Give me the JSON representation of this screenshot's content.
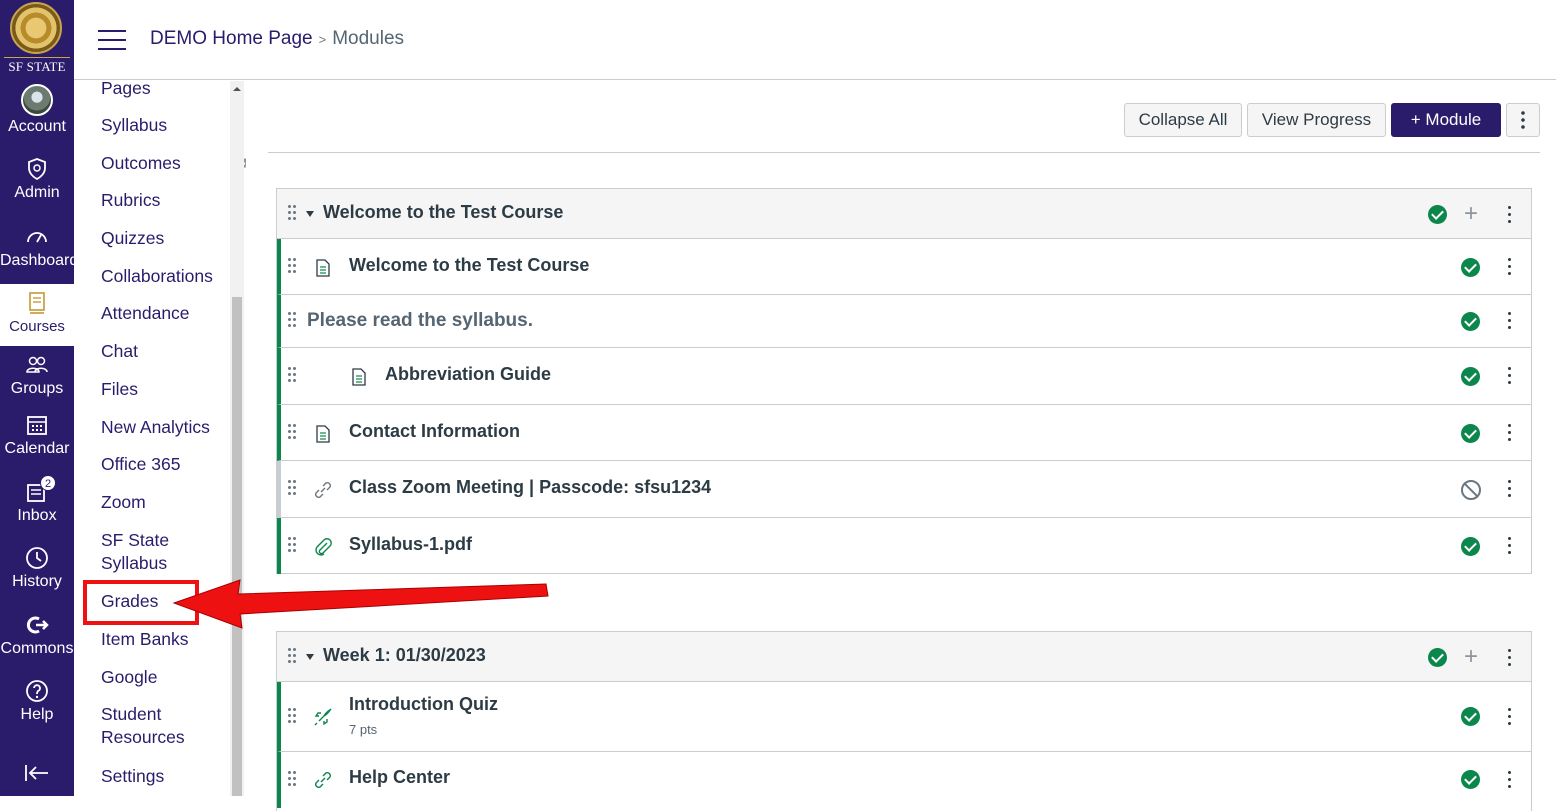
{
  "global_nav": {
    "logo_text": "SF STATE",
    "items": [
      {
        "label": "Account",
        "icon": "avatar-icon"
      },
      {
        "label": "Admin",
        "icon": "shield-icon"
      },
      {
        "label": "Dashboard",
        "icon": "dashboard-icon"
      },
      {
        "label": "Courses",
        "icon": "book-icon"
      },
      {
        "label": "Groups",
        "icon": "users-icon"
      },
      {
        "label": "Calendar",
        "icon": "calendar-icon"
      },
      {
        "label": "Inbox",
        "icon": "inbox-icon",
        "badge": "2"
      },
      {
        "label": "History",
        "icon": "clock-icon"
      },
      {
        "label": "Commons",
        "icon": "commons-icon"
      },
      {
        "label": "Help",
        "icon": "help-icon"
      }
    ],
    "active": "Courses"
  },
  "header": {
    "breadcrumb": [
      "DEMO Home Page",
      "Modules"
    ]
  },
  "course_nav": {
    "items": [
      "Pages",
      "Syllabus",
      "Outcomes",
      "Rubrics",
      "Quizzes",
      "Collaborations",
      "Attendance",
      "Chat",
      "Files",
      "New Analytics",
      "Office 365",
      "Zoom",
      "SF State Syllabus",
      "Grades",
      "Item Banks",
      "Google",
      "Student Resources",
      "Settings"
    ],
    "hidden_items": [
      "Outcomes"
    ],
    "highlighted": "Grades"
  },
  "toolbar": {
    "collapse_all": "Collapse All",
    "view_progress": "View Progress",
    "add_module": "+ Module"
  },
  "modules": [
    {
      "title": "Welcome to the Test Course",
      "items": [
        {
          "title": "Welcome to the Test Course",
          "type": "page",
          "status": "published"
        },
        {
          "title": "Please read the syllabus.",
          "type": "subheader",
          "status": "published"
        },
        {
          "title": "Abbreviation Guide",
          "type": "page",
          "status": "published",
          "indent": 1
        },
        {
          "title": "Contact Information",
          "type": "page",
          "status": "published"
        },
        {
          "title": "Class Zoom Meeting | Passcode: sfsu1234",
          "type": "link",
          "status": "unpublished"
        },
        {
          "title": "Syllabus-1.pdf",
          "type": "file",
          "status": "published"
        }
      ]
    },
    {
      "title": "Week 1: 01/30/2023",
      "items": [
        {
          "title": "Introduction Quiz",
          "sub": "7 pts",
          "type": "quiz",
          "status": "published"
        },
        {
          "title": "Help Center",
          "type": "link",
          "status": "published"
        }
      ]
    }
  ],
  "colors": {
    "brand": "#2a1c6b",
    "success": "#0b874b",
    "highlight": "#ee1111"
  }
}
